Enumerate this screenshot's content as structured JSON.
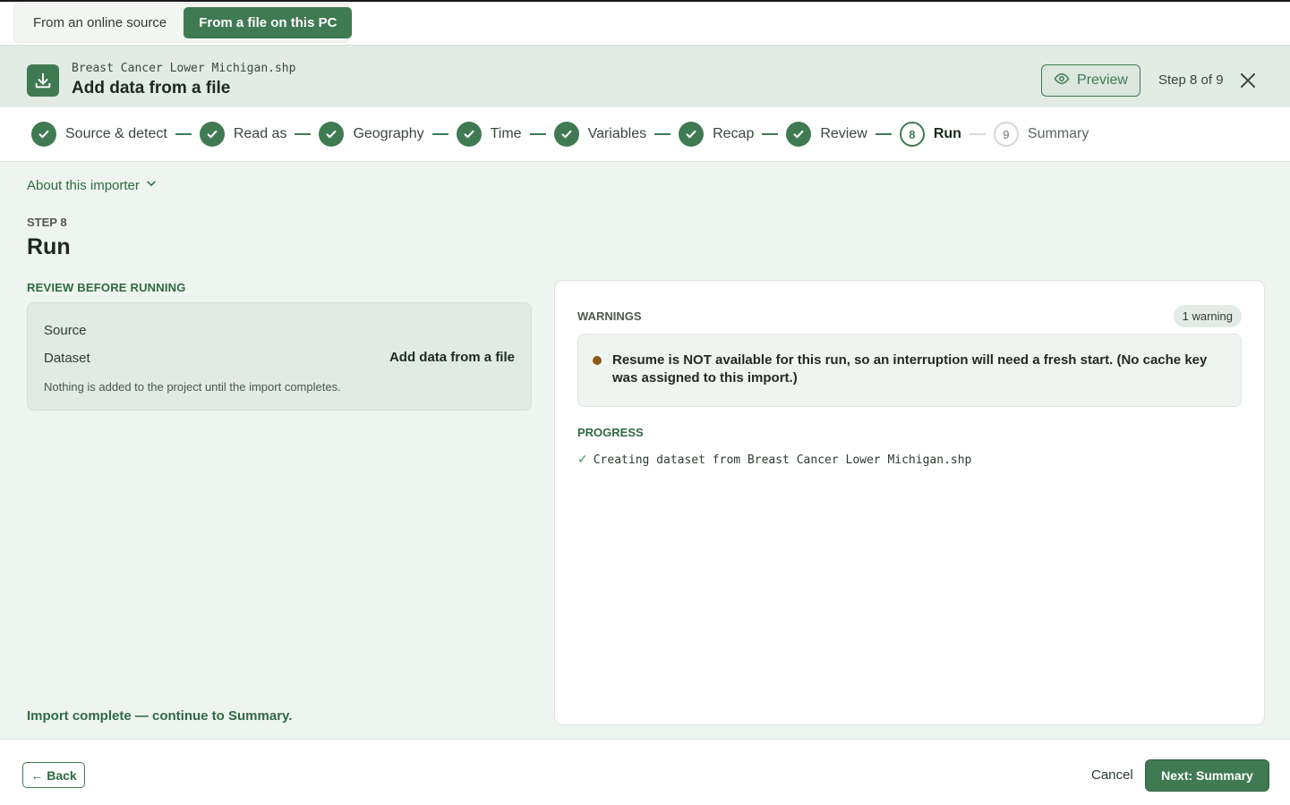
{
  "source_tabs": [
    {
      "label": "From an online source",
      "active": false
    },
    {
      "label": "From a file on this PC",
      "active": true
    }
  ],
  "header": {
    "filename": "Breast Cancer Lower Michigan.shp",
    "title": "Add data from a file",
    "preview_label": "Preview",
    "step_count": "Step 8 of 9"
  },
  "stepper": {
    "steps": [
      {
        "label": "Source & detect",
        "state": "done",
        "number": "1"
      },
      {
        "label": "Read as",
        "state": "done",
        "number": "2"
      },
      {
        "label": "Geography",
        "state": "done",
        "number": "3"
      },
      {
        "label": "Time",
        "state": "done",
        "number": "4"
      },
      {
        "label": "Variables",
        "state": "done",
        "number": "5"
      },
      {
        "label": "Recap",
        "state": "done",
        "number": "6"
      },
      {
        "label": "Review",
        "state": "done",
        "number": "7"
      },
      {
        "label": "Run",
        "state": "current",
        "number": "8"
      },
      {
        "label": "Summary",
        "state": "future",
        "number": "9"
      }
    ]
  },
  "main": {
    "about_label": "About this importer",
    "step_kicker": "STEP 8",
    "title": "Run",
    "review_kicker": "REVIEW BEFORE RUNNING",
    "review": {
      "source_label": "Source",
      "dataset_label": "Dataset",
      "dataset_value": "Add data from a file",
      "note": "Nothing is added to the project until the import completes."
    },
    "complete_message": "Import complete — continue to Summary."
  },
  "panel": {
    "warnings_kicker": "WARNINGS",
    "warnings_badge": "1 warning",
    "warning_text": "Resume is NOT available for this run, so an interruption will need a fresh start. (No cache key was assigned to this import.)",
    "progress_kicker": "PROGRESS",
    "progress_items": [
      {
        "check": "✓",
        "text": "Creating dataset from Breast Cancer Lower Michigan.shp"
      }
    ]
  },
  "footer": {
    "back_label": "← Back",
    "cancel_label": "Cancel",
    "next_label": "Next: Summary"
  },
  "colors": {
    "accent": "#3f7a52",
    "warning_dot": "#8c5a12",
    "panel_bg": "#eef4f0"
  }
}
